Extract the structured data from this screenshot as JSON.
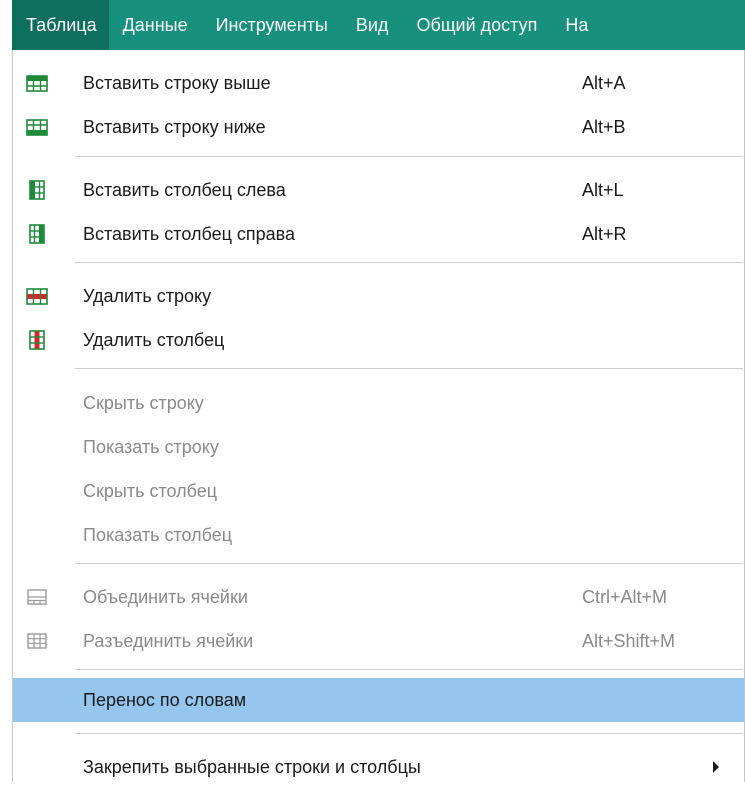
{
  "menubar": {
    "items": [
      "Таблица",
      "Данные",
      "Инструменты",
      "Вид",
      "Общий доступ",
      "На"
    ],
    "active_index": 0
  },
  "dropdown": {
    "insert_row_above": {
      "label": "Вставить строку выше",
      "shortcut": "Alt+A",
      "icon": "insert-row-above-icon"
    },
    "insert_row_below": {
      "label": "Вставить строку ниже",
      "shortcut": "Alt+B",
      "icon": "insert-row-below-icon"
    },
    "insert_col_left": {
      "label": "Вставить столбец слева",
      "shortcut": "Alt+L",
      "icon": "insert-column-left-icon"
    },
    "insert_col_right": {
      "label": "Вставить столбец справа",
      "shortcut": "Alt+R",
      "icon": "insert-column-right-icon"
    },
    "delete_row": {
      "label": "Удалить строку",
      "icon": "delete-row-icon"
    },
    "delete_col": {
      "label": "Удалить столбец",
      "icon": "delete-column-icon"
    },
    "hide_row": {
      "label": "Скрыть строку",
      "disabled": true
    },
    "show_row": {
      "label": "Показать строку",
      "disabled": true
    },
    "hide_col": {
      "label": "Скрыть столбец",
      "disabled": true
    },
    "show_col": {
      "label": "Показать столбец",
      "disabled": true
    },
    "merge_cells": {
      "label": "Объединить ячейки",
      "shortcut": "Ctrl+Alt+M",
      "disabled": true,
      "icon": "merge-cells-icon"
    },
    "unmerge_cells": {
      "label": "Разъединить ячейки",
      "shortcut": "Alt+Shift+M",
      "disabled": true,
      "icon": "unmerge-cells-icon"
    },
    "word_wrap": {
      "label": "Перенос по словам",
      "highlighted": true
    },
    "freeze": {
      "label": "Закрепить выбранные строки и столбцы",
      "has_submenu": true
    }
  },
  "colors": {
    "menubar_bg": "#17917d",
    "menubar_active_bg": "#0e6f5f",
    "highlight_bg": "#95c6f0",
    "icon_green": "#1d8a3a",
    "icon_red": "#d6262c",
    "disabled_text": "#8a8a8a"
  }
}
